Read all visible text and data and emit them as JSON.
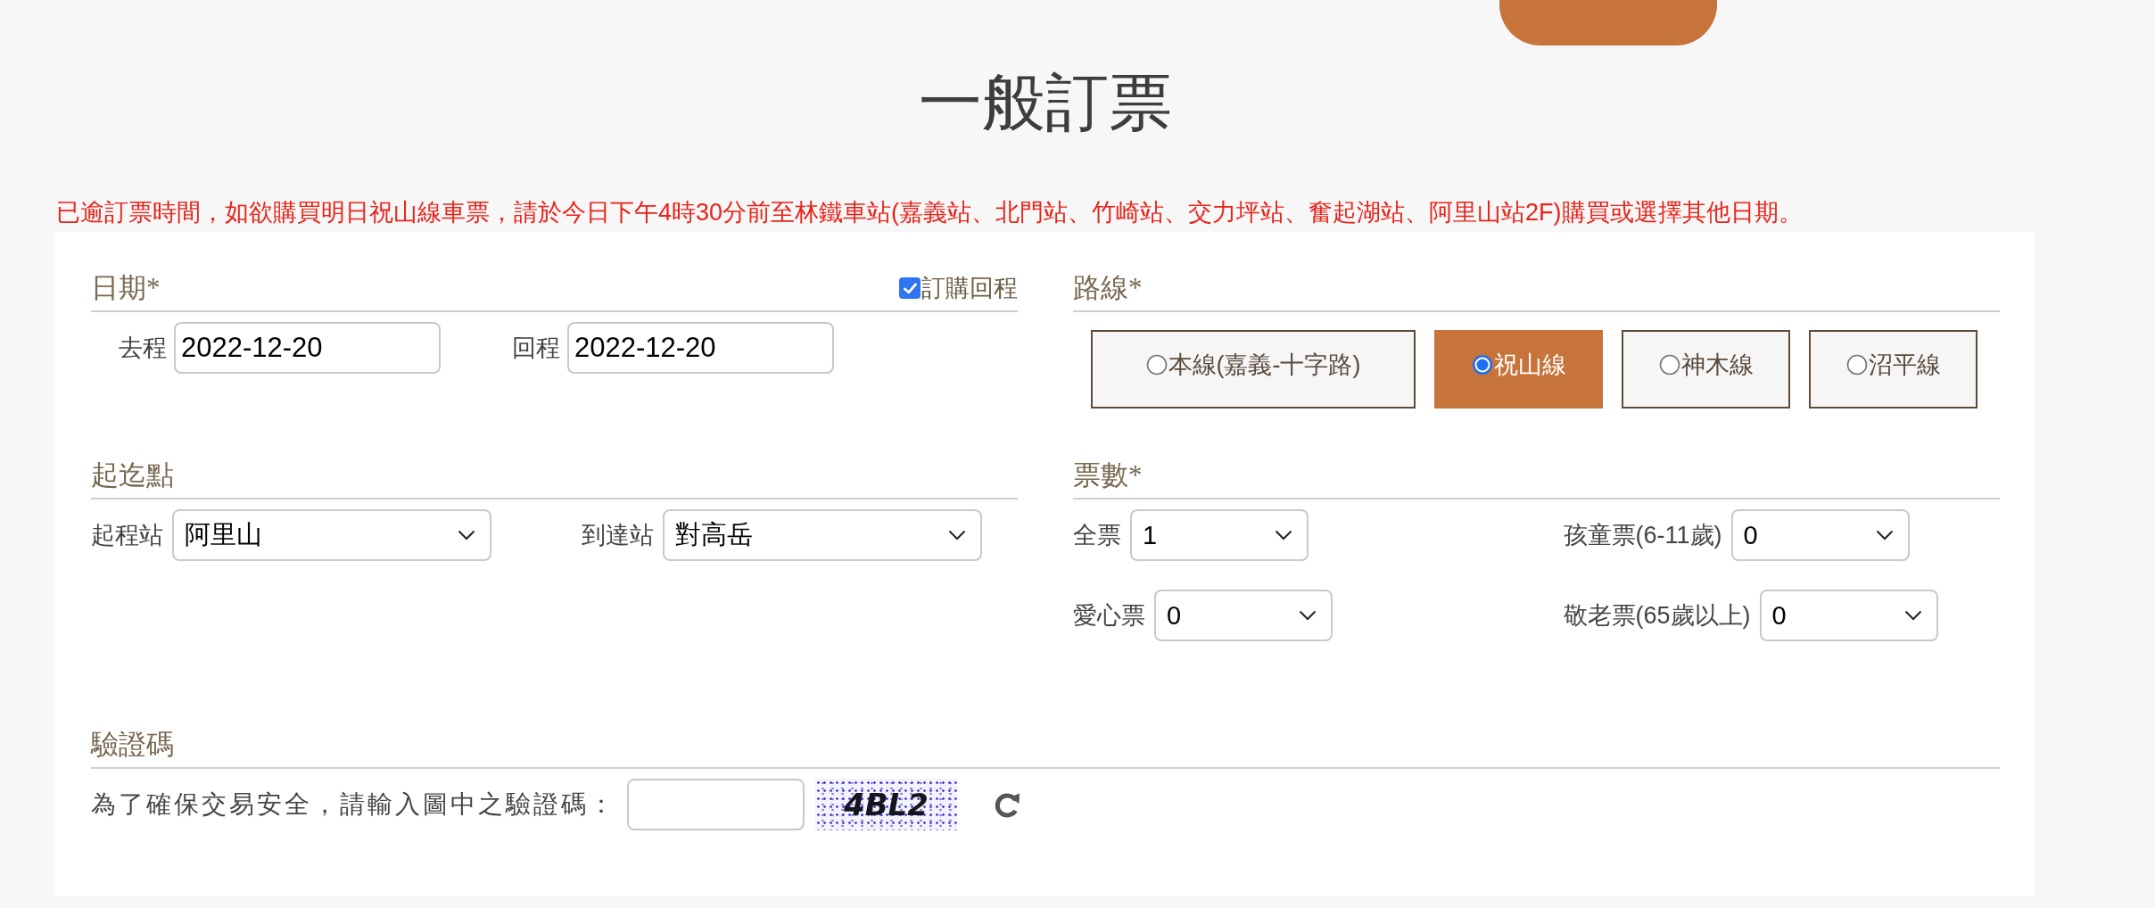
{
  "title": "一般訂票",
  "notice": "已逾訂票時間，如欲購買明日祝山線車票，請於今日下午4時30分前至林鐵車站(嘉義站、北門站、竹崎站、交力坪站、奮起湖站、阿里山站2F)購買或選擇其他日期。",
  "date_section": {
    "heading": "日期*",
    "return_trip": {
      "label": "訂購回程",
      "checked": true
    },
    "fields": [
      {
        "label": "去程",
        "value": "2022-12-20"
      },
      {
        "label": "回程",
        "value": "2022-12-20"
      }
    ]
  },
  "route_section": {
    "heading": "路線*",
    "options": [
      {
        "label": "本線(嘉義-十字路)",
        "selected": false
      },
      {
        "label": "祝山線",
        "selected": true
      },
      {
        "label": "神木線",
        "selected": false
      },
      {
        "label": "沼平線",
        "selected": false
      }
    ]
  },
  "stations_section": {
    "heading": "起迄點",
    "fields": [
      {
        "label": "起程站",
        "value": "阿里山"
      },
      {
        "label": "到達站",
        "value": "對高岳"
      }
    ]
  },
  "tickets_section": {
    "heading": "票數*",
    "fields": [
      {
        "label": "全票",
        "value": "1"
      },
      {
        "label": "孩童票(6-11歲)",
        "value": "0"
      },
      {
        "label": "愛心票",
        "value": "0"
      },
      {
        "label": "敬老票(65歲以上)",
        "value": "0"
      }
    ]
  },
  "captcha_section": {
    "heading": "驗證碼",
    "prompt": "為了確保交易安全，請輸入圖中之驗證碼：",
    "code": "4BL2"
  }
}
